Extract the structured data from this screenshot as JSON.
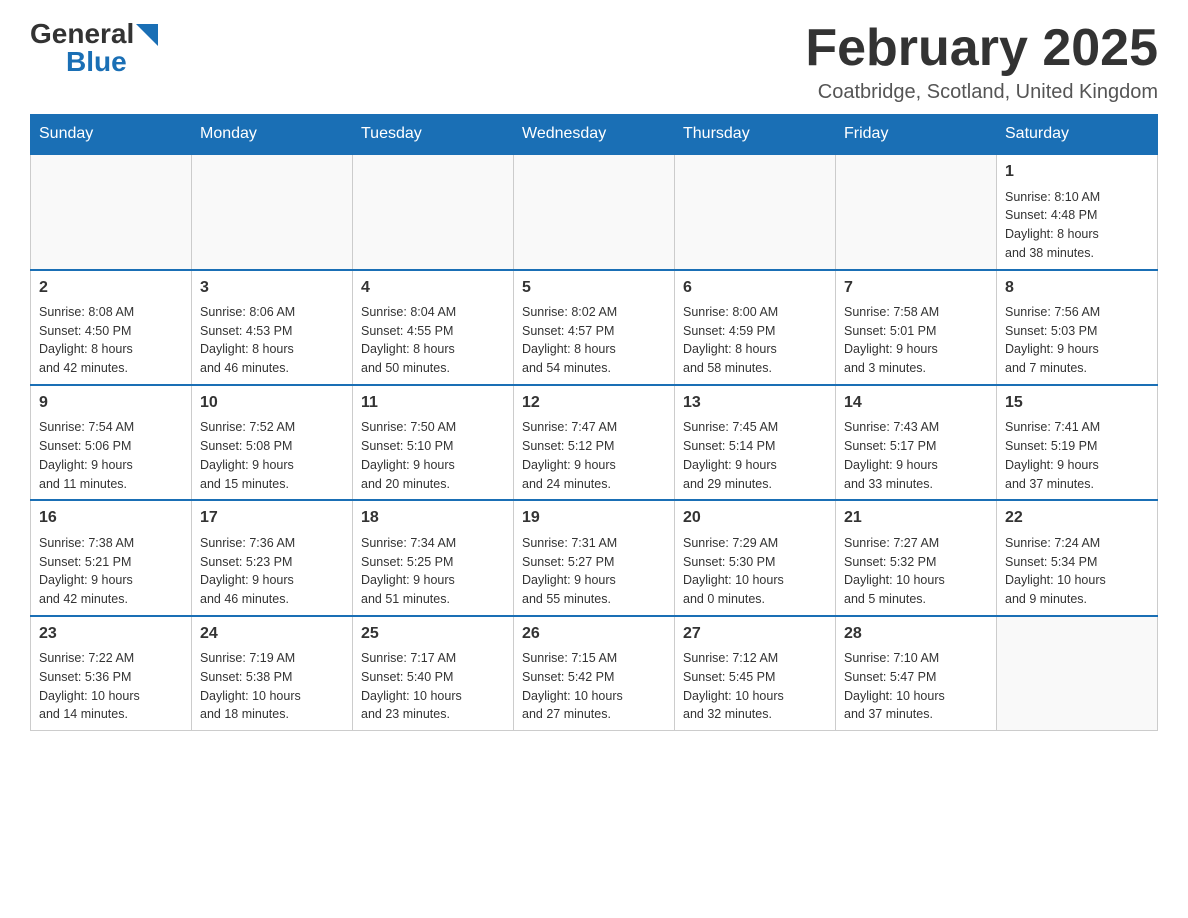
{
  "header": {
    "logo_general": "General",
    "logo_blue": "Blue",
    "month_title": "February 2025",
    "location": "Coatbridge, Scotland, United Kingdom"
  },
  "weekdays": [
    "Sunday",
    "Monday",
    "Tuesday",
    "Wednesday",
    "Thursday",
    "Friday",
    "Saturday"
  ],
  "weeks": [
    [
      {
        "day": "",
        "info": []
      },
      {
        "day": "",
        "info": []
      },
      {
        "day": "",
        "info": []
      },
      {
        "day": "",
        "info": []
      },
      {
        "day": "",
        "info": []
      },
      {
        "day": "",
        "info": []
      },
      {
        "day": "1",
        "info": [
          "Sunrise: 8:10 AM",
          "Sunset: 4:48 PM",
          "Daylight: 8 hours",
          "and 38 minutes."
        ]
      }
    ],
    [
      {
        "day": "2",
        "info": [
          "Sunrise: 8:08 AM",
          "Sunset: 4:50 PM",
          "Daylight: 8 hours",
          "and 42 minutes."
        ]
      },
      {
        "day": "3",
        "info": [
          "Sunrise: 8:06 AM",
          "Sunset: 4:53 PM",
          "Daylight: 8 hours",
          "and 46 minutes."
        ]
      },
      {
        "day": "4",
        "info": [
          "Sunrise: 8:04 AM",
          "Sunset: 4:55 PM",
          "Daylight: 8 hours",
          "and 50 minutes."
        ]
      },
      {
        "day": "5",
        "info": [
          "Sunrise: 8:02 AM",
          "Sunset: 4:57 PM",
          "Daylight: 8 hours",
          "and 54 minutes."
        ]
      },
      {
        "day": "6",
        "info": [
          "Sunrise: 8:00 AM",
          "Sunset: 4:59 PM",
          "Daylight: 8 hours",
          "and 58 minutes."
        ]
      },
      {
        "day": "7",
        "info": [
          "Sunrise: 7:58 AM",
          "Sunset: 5:01 PM",
          "Daylight: 9 hours",
          "and 3 minutes."
        ]
      },
      {
        "day": "8",
        "info": [
          "Sunrise: 7:56 AM",
          "Sunset: 5:03 PM",
          "Daylight: 9 hours",
          "and 7 minutes."
        ]
      }
    ],
    [
      {
        "day": "9",
        "info": [
          "Sunrise: 7:54 AM",
          "Sunset: 5:06 PM",
          "Daylight: 9 hours",
          "and 11 minutes."
        ]
      },
      {
        "day": "10",
        "info": [
          "Sunrise: 7:52 AM",
          "Sunset: 5:08 PM",
          "Daylight: 9 hours",
          "and 15 minutes."
        ]
      },
      {
        "day": "11",
        "info": [
          "Sunrise: 7:50 AM",
          "Sunset: 5:10 PM",
          "Daylight: 9 hours",
          "and 20 minutes."
        ]
      },
      {
        "day": "12",
        "info": [
          "Sunrise: 7:47 AM",
          "Sunset: 5:12 PM",
          "Daylight: 9 hours",
          "and 24 minutes."
        ]
      },
      {
        "day": "13",
        "info": [
          "Sunrise: 7:45 AM",
          "Sunset: 5:14 PM",
          "Daylight: 9 hours",
          "and 29 minutes."
        ]
      },
      {
        "day": "14",
        "info": [
          "Sunrise: 7:43 AM",
          "Sunset: 5:17 PM",
          "Daylight: 9 hours",
          "and 33 minutes."
        ]
      },
      {
        "day": "15",
        "info": [
          "Sunrise: 7:41 AM",
          "Sunset: 5:19 PM",
          "Daylight: 9 hours",
          "and 37 minutes."
        ]
      }
    ],
    [
      {
        "day": "16",
        "info": [
          "Sunrise: 7:38 AM",
          "Sunset: 5:21 PM",
          "Daylight: 9 hours",
          "and 42 minutes."
        ]
      },
      {
        "day": "17",
        "info": [
          "Sunrise: 7:36 AM",
          "Sunset: 5:23 PM",
          "Daylight: 9 hours",
          "and 46 minutes."
        ]
      },
      {
        "day": "18",
        "info": [
          "Sunrise: 7:34 AM",
          "Sunset: 5:25 PM",
          "Daylight: 9 hours",
          "and 51 minutes."
        ]
      },
      {
        "day": "19",
        "info": [
          "Sunrise: 7:31 AM",
          "Sunset: 5:27 PM",
          "Daylight: 9 hours",
          "and 55 minutes."
        ]
      },
      {
        "day": "20",
        "info": [
          "Sunrise: 7:29 AM",
          "Sunset: 5:30 PM",
          "Daylight: 10 hours",
          "and 0 minutes."
        ]
      },
      {
        "day": "21",
        "info": [
          "Sunrise: 7:27 AM",
          "Sunset: 5:32 PM",
          "Daylight: 10 hours",
          "and 5 minutes."
        ]
      },
      {
        "day": "22",
        "info": [
          "Sunrise: 7:24 AM",
          "Sunset: 5:34 PM",
          "Daylight: 10 hours",
          "and 9 minutes."
        ]
      }
    ],
    [
      {
        "day": "23",
        "info": [
          "Sunrise: 7:22 AM",
          "Sunset: 5:36 PM",
          "Daylight: 10 hours",
          "and 14 minutes."
        ]
      },
      {
        "day": "24",
        "info": [
          "Sunrise: 7:19 AM",
          "Sunset: 5:38 PM",
          "Daylight: 10 hours",
          "and 18 minutes."
        ]
      },
      {
        "day": "25",
        "info": [
          "Sunrise: 7:17 AM",
          "Sunset: 5:40 PM",
          "Daylight: 10 hours",
          "and 23 minutes."
        ]
      },
      {
        "day": "26",
        "info": [
          "Sunrise: 7:15 AM",
          "Sunset: 5:42 PM",
          "Daylight: 10 hours",
          "and 27 minutes."
        ]
      },
      {
        "day": "27",
        "info": [
          "Sunrise: 7:12 AM",
          "Sunset: 5:45 PM",
          "Daylight: 10 hours",
          "and 32 minutes."
        ]
      },
      {
        "day": "28",
        "info": [
          "Sunrise: 7:10 AM",
          "Sunset: 5:47 PM",
          "Daylight: 10 hours",
          "and 37 minutes."
        ]
      },
      {
        "day": "",
        "info": []
      }
    ]
  ]
}
